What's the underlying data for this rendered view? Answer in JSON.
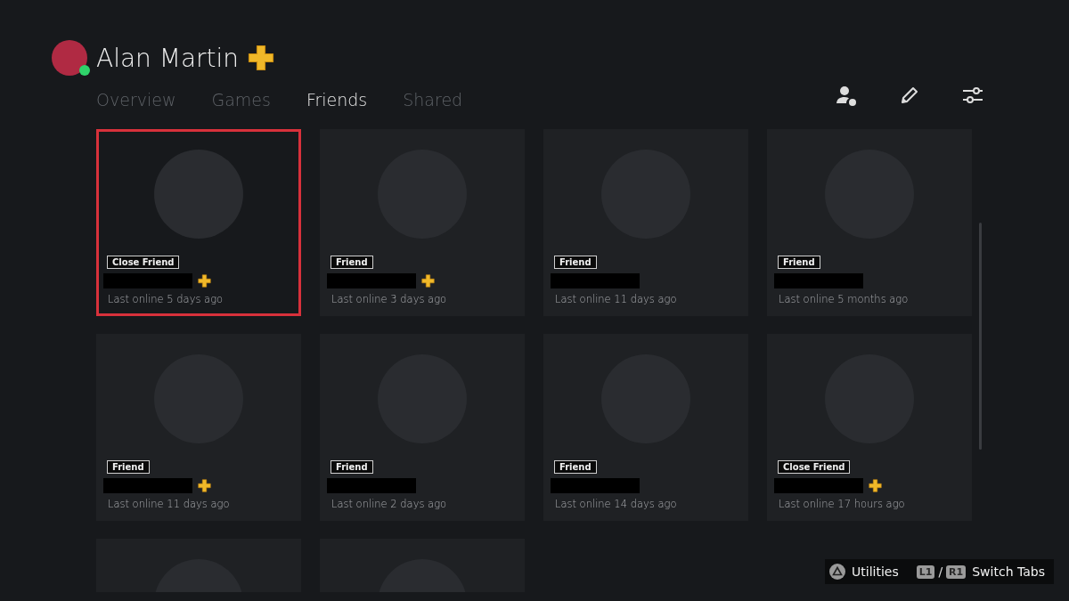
{
  "profile": {
    "name": "Alan Martin",
    "plus": true,
    "online": true
  },
  "tabs": [
    {
      "label": "Overview",
      "selected": false
    },
    {
      "label": "Games",
      "selected": false
    },
    {
      "label": "Friends",
      "selected": true
    },
    {
      "label": "Shared",
      "selected": false
    }
  ],
  "friends": [
    {
      "kind": "full",
      "tag": "Close Friend",
      "plus": true,
      "last_online": "Last online 5 days ago",
      "selected": true
    },
    {
      "kind": "full",
      "tag": "Friend",
      "plus": true,
      "last_online": "Last online 3 days ago",
      "selected": false
    },
    {
      "kind": "full",
      "tag": "Friend",
      "plus": false,
      "last_online": "Last online 11 days ago",
      "selected": false
    },
    {
      "kind": "full",
      "tag": "Friend",
      "plus": false,
      "last_online": "Last online 5 months ago",
      "selected": false
    },
    {
      "kind": "full",
      "tag": "Friend",
      "plus": true,
      "last_online": "Last online 11 days ago",
      "selected": false
    },
    {
      "kind": "full",
      "tag": "Friend",
      "plus": false,
      "last_online": "Last online 2 days ago",
      "selected": false
    },
    {
      "kind": "full",
      "tag": "Friend",
      "plus": false,
      "last_online": "Last online 14 days ago",
      "selected": false
    },
    {
      "kind": "full",
      "tag": "Close Friend",
      "plus": true,
      "last_online": "Last online 17 hours ago",
      "selected": false
    },
    {
      "kind": "partial",
      "selected": false
    },
    {
      "kind": "partial",
      "selected": false
    }
  ],
  "hints": [
    {
      "kind": "triangle",
      "label": "Utilities"
    },
    {
      "kind": "shoulders",
      "keys": [
        "L1",
        "R1"
      ],
      "separator": "/",
      "label": "Switch Tabs"
    }
  ]
}
